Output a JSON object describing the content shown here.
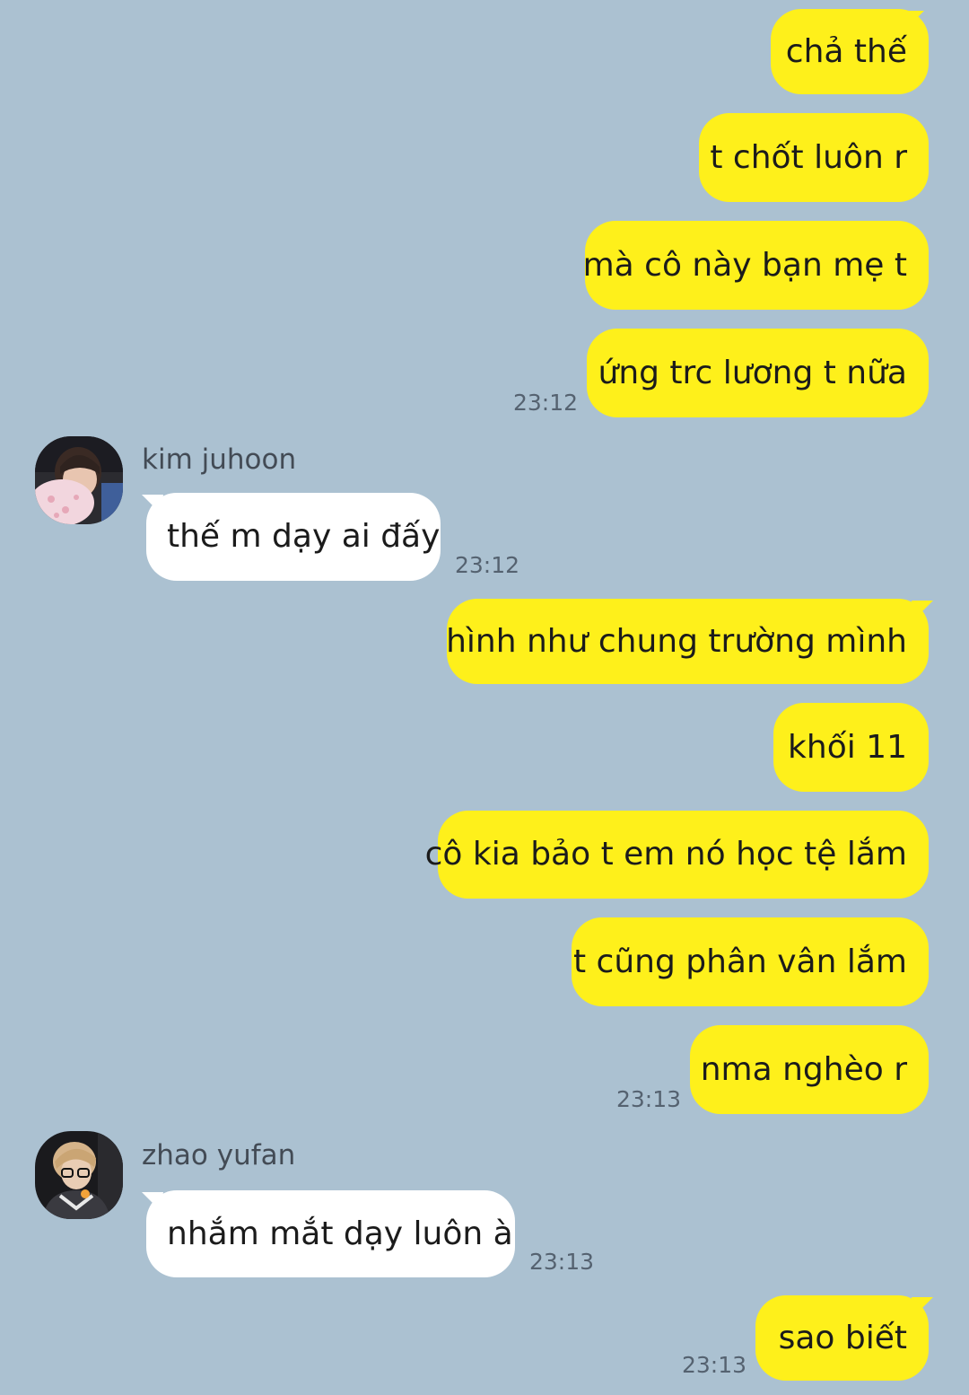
{
  "colors": {
    "background": "#abc1d1",
    "my_bubble": "#fef01b",
    "their_bubble": "#ffffff",
    "timestamp": "#556270"
  },
  "messages": [
    {
      "from": "me",
      "text": "chả thế"
    },
    {
      "from": "me",
      "text": "t chốt luôn r"
    },
    {
      "from": "me",
      "text": "mà cô này bạn mẹ t"
    },
    {
      "from": "me",
      "text": "ứng trc lương t nữa",
      "time": "23:12"
    },
    {
      "from": "kim juhoon",
      "text": "thế m dạy ai đấy",
      "time": "23:12"
    },
    {
      "from": "me",
      "text": "hình như chung trường mình"
    },
    {
      "from": "me",
      "text": "khối 11"
    },
    {
      "from": "me",
      "text": "cô kia bảo t em nó học tệ lắm"
    },
    {
      "from": "me",
      "text": "t cũng phân vân lắm"
    },
    {
      "from": "me",
      "text": "nma nghèo r",
      "time": "23:13"
    },
    {
      "from": "zhao yufan",
      "text": "nhắm mắt dạy luôn à",
      "time": "23:13"
    },
    {
      "from": "me",
      "text": "sao biết",
      "time": "23:13"
    }
  ],
  "senders": {
    "kim_juhoon": {
      "name": "kim juhoon",
      "avatar_icon": "profile-photo-icon"
    },
    "zhao_yufan": {
      "name": "zhao yufan",
      "avatar_icon": "profile-photo-icon"
    }
  }
}
